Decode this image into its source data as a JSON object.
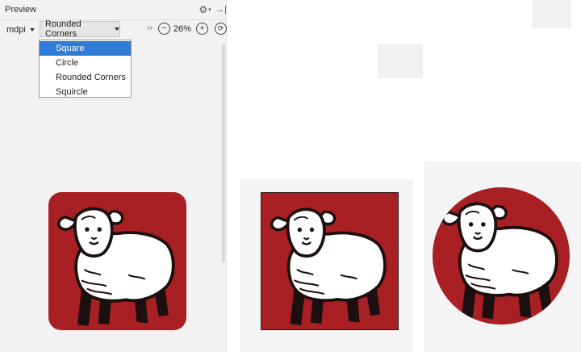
{
  "panel": {
    "title": "Preview",
    "gear_icon": "gear-icon",
    "hide_icon": "hide-panel-icon"
  },
  "toolbar": {
    "density": "mdpi",
    "shape": "Rounded Corners",
    "overflow": "››",
    "zoom_out_symbol": "−",
    "zoom_level": "26%",
    "zoom_in_symbol": "+",
    "reset_symbol": "⟳"
  },
  "shape_menu": {
    "selected": "Square",
    "options": [
      "Square",
      "Circle",
      "Rounded Corners",
      "Squircle"
    ]
  },
  "icons": [
    {
      "name": "sheep-icon",
      "shape": "rounded-corners"
    },
    {
      "name": "sheep-icon",
      "shape": "square"
    },
    {
      "name": "sheep-icon",
      "shape": "circle"
    }
  ],
  "colors": {
    "icon_background": "#a81f24",
    "sheep_wool": "#ffffff",
    "sheep_outline": "#1c0f0f",
    "menu_selected": "#2f7bd6"
  }
}
